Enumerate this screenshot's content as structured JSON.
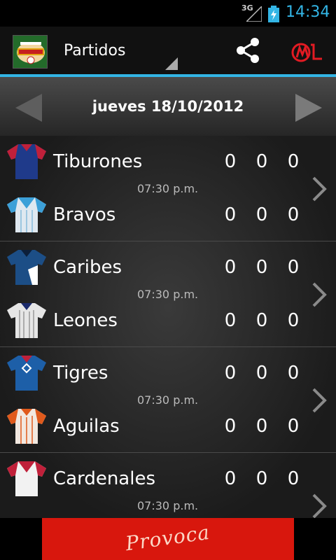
{
  "status_bar": {
    "network": "3G",
    "time": "14:34"
  },
  "action_bar": {
    "title": "Partidos",
    "logo_icon": "baseball-league-logo",
    "share_icon": "share-icon",
    "brand_icon": "brand-logo"
  },
  "date_nav": {
    "date": "jueves 18/10/2012"
  },
  "games": [
    {
      "time": "07:30 p.m.",
      "home": {
        "name": "Tiburones",
        "scores": [
          "0",
          "0",
          "0"
        ],
        "jersey_colors": [
          "#1f3a8a",
          "#c0203a"
        ]
      },
      "away": {
        "name": "Bravos",
        "scores": [
          "0",
          "0",
          "0"
        ],
        "jersey_colors": [
          "#dfe8f0",
          "#3ca0d8"
        ]
      }
    },
    {
      "time": "07:30 p.m.",
      "home": {
        "name": "Caribes",
        "scores": [
          "0",
          "0",
          "0"
        ],
        "jersey_colors": [
          "#1c4e86",
          "#ffffff"
        ]
      },
      "away": {
        "name": "Leones",
        "scores": [
          "0",
          "0",
          "0"
        ],
        "jersey_colors": [
          "#e6e6e6",
          "#1a2a6c"
        ]
      }
    },
    {
      "time": "07:30 p.m.",
      "home": {
        "name": "Tigres",
        "scores": [
          "0",
          "0",
          "0"
        ],
        "jersey_colors": [
          "#1d5fa8",
          "#c0203a"
        ]
      },
      "away": {
        "name": "Aguilas",
        "scores": [
          "0",
          "0",
          "0"
        ],
        "jersey_colors": [
          "#f2e8e0",
          "#e05a1c"
        ]
      }
    },
    {
      "time": "07:30 p.m.",
      "home": {
        "name": "Cardenales",
        "scores": [
          "0",
          "0",
          "0"
        ],
        "jersey_colors": [
          "#f2f2f2",
          "#c0203a"
        ]
      }
    }
  ],
  "ad": {
    "text": "Provoca"
  },
  "colors": {
    "accent": "#33b5e5",
    "ad_background": "#d8170d"
  }
}
